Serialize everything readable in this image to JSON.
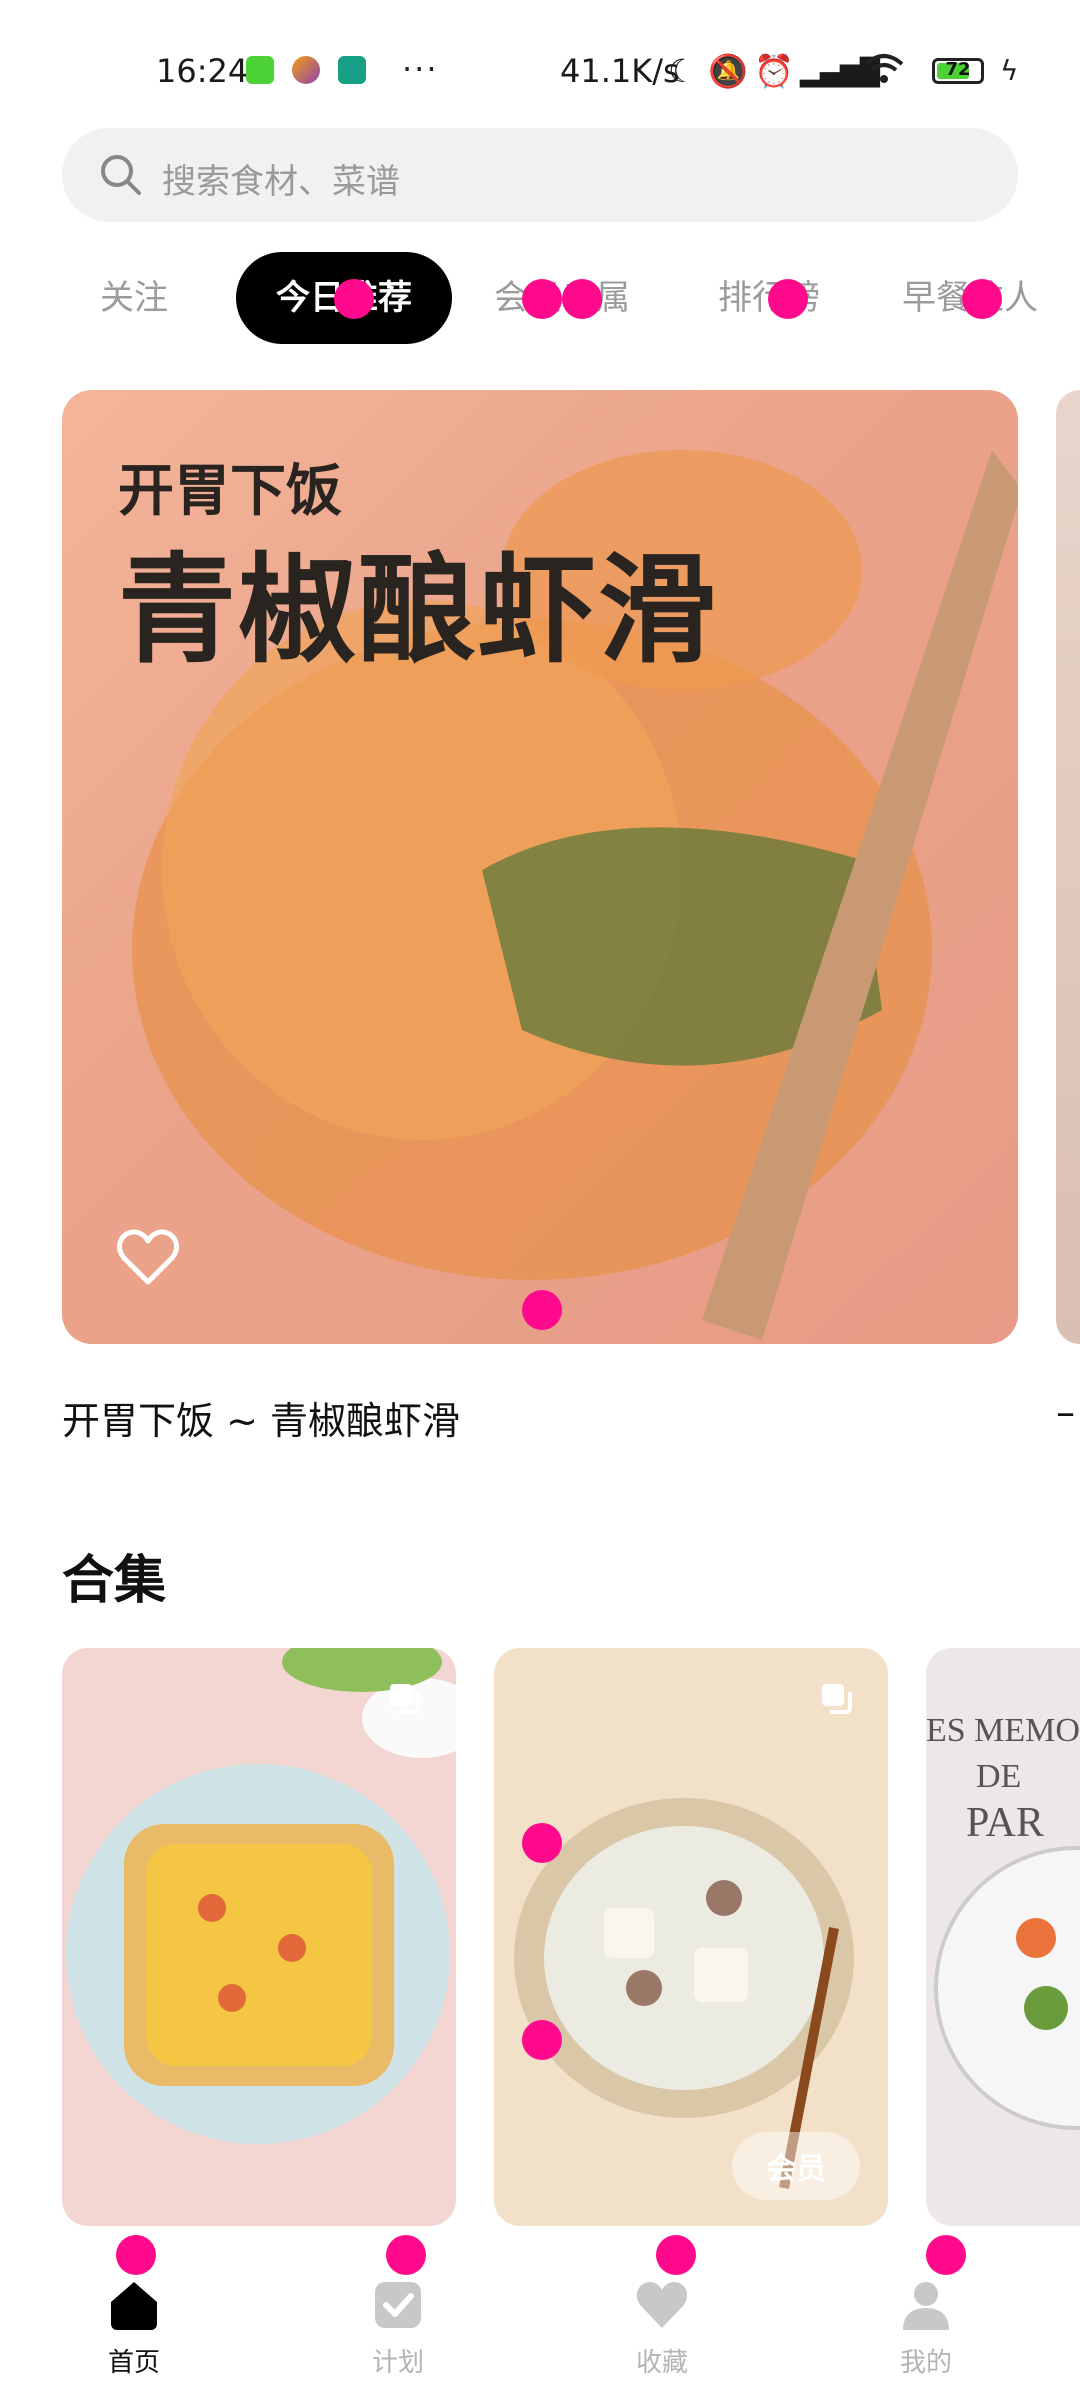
{
  "status": {
    "time": "16:24",
    "dots": "···",
    "net_speed": "41.1K/s",
    "battery": "72"
  },
  "search": {
    "placeholder": "搜索食材、菜谱"
  },
  "tabs": [
    {
      "label": "关注"
    },
    {
      "label": "今日推荐"
    },
    {
      "label": "会员专属"
    },
    {
      "label": "排行榜"
    },
    {
      "label": "早餐达人"
    }
  ],
  "hero": {
    "subtitle": "开胃下饭",
    "title": "青椒酿虾滑",
    "caption": "开胃下饭 ~ 青椒酿虾滑",
    "more": "–"
  },
  "section": {
    "title": "合集"
  },
  "collections": [
    {
      "icon": "pizza-image"
    },
    {
      "icon": "soup-image",
      "badge": "会员"
    },
    {
      "icon": "salad-image",
      "overlay_text_1": "ES MEMO",
      "overlay_text_2": "DE",
      "overlay_text_3": "PAR"
    }
  ],
  "nav": [
    {
      "label": "首页",
      "icon": "home-icon"
    },
    {
      "label": "计划",
      "icon": "plan-check-icon"
    },
    {
      "label": "收藏",
      "icon": "favorite-heart-icon"
    },
    {
      "label": "我的",
      "icon": "profile-icon"
    }
  ],
  "colors": {
    "accent": "#000000",
    "marker": "#ff0a8c",
    "inactive": "#9b9b9b"
  }
}
